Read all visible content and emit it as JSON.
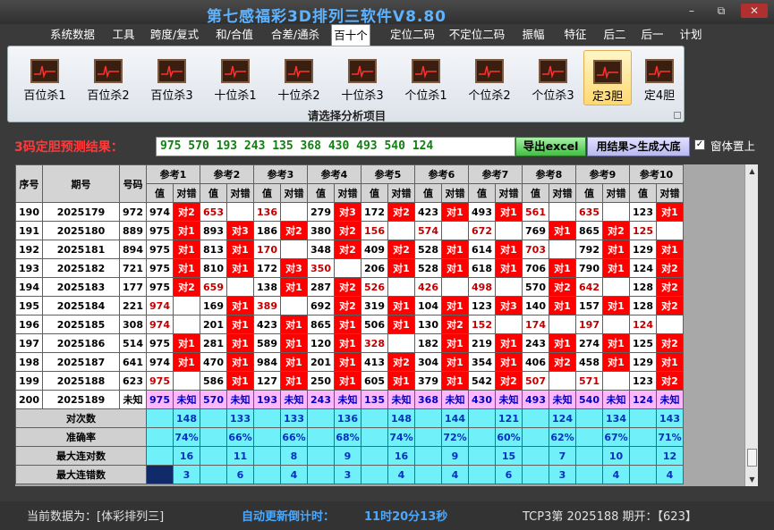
{
  "window": {
    "title": "第七感福彩3D排列三软件V8.80",
    "min": "–",
    "max": "⧉",
    "close": "✕"
  },
  "menu": [
    "系统数据",
    "工具",
    "跨度/复式",
    "和/合值",
    "合差/通杀",
    "百十个",
    "定位二码",
    "不定位二码",
    "振幅",
    "特征",
    "后二",
    "后一",
    "计划"
  ],
  "menu_active": 5,
  "ribbon": {
    "buttons": [
      "百位杀1",
      "百位杀2",
      "百位杀3",
      "十位杀1",
      "十位杀2",
      "十位杀3",
      "个位杀1",
      "个位杀2",
      "个位杀3",
      "定3胆",
      "定4胆"
    ],
    "selected": 9,
    "caption": "请选择分析项目",
    "icon": "chart-icon"
  },
  "predict": {
    "label": "3码定胆预测结果：",
    "value": "975 570 193 243 135 368 430 493 540 124",
    "export_label": "导出excel",
    "gen_label": "用结果>生成大底",
    "ontop_label": "窗体置上",
    "ontop_checked": "✓"
  },
  "table": {
    "col_headers": [
      "序号",
      "期号",
      "号码"
    ],
    "refs": [
      "参考1",
      "参考2",
      "参考3",
      "参考4",
      "参考5",
      "参考6",
      "参考7",
      "参考8",
      "参考9",
      "参考10"
    ],
    "sub": [
      "值",
      "对错"
    ],
    "rows": [
      {
        "no": "190",
        "issue": "2025179",
        "num": "972",
        "cells": [
          [
            "974",
            "对2"
          ],
          [
            "653",
            ""
          ],
          [
            "136",
            ""
          ],
          [
            "279",
            "对3"
          ],
          [
            "172",
            "对2"
          ],
          [
            "423",
            "对1"
          ],
          [
            "493",
            "对1"
          ],
          [
            "561",
            ""
          ],
          [
            "635",
            ""
          ],
          [
            "123",
            "对1"
          ]
        ]
      },
      {
        "no": "191",
        "issue": "2025180",
        "num": "889",
        "cells": [
          [
            "975",
            "对1"
          ],
          [
            "893",
            "对3"
          ],
          [
            "186",
            "对2"
          ],
          [
            "380",
            "对2"
          ],
          [
            "156",
            ""
          ],
          [
            "574",
            ""
          ],
          [
            "672",
            ""
          ],
          [
            "769",
            "对1"
          ],
          [
            "865",
            "对2"
          ],
          [
            "125",
            ""
          ]
        ]
      },
      {
        "no": "192",
        "issue": "2025181",
        "num": "894",
        "cells": [
          [
            "975",
            "对1"
          ],
          [
            "813",
            "对1"
          ],
          [
            "170",
            ""
          ],
          [
            "348",
            "对2"
          ],
          [
            "409",
            "对2"
          ],
          [
            "528",
            "对1"
          ],
          [
            "614",
            "对1"
          ],
          [
            "703",
            ""
          ],
          [
            "792",
            "对1"
          ],
          [
            "129",
            "对1"
          ]
        ]
      },
      {
        "no": "193",
        "issue": "2025182",
        "num": "721",
        "cells": [
          [
            "975",
            "对1"
          ],
          [
            "810",
            "对1"
          ],
          [
            "172",
            "对3"
          ],
          [
            "350",
            ""
          ],
          [
            "206",
            "对1"
          ],
          [
            "528",
            "对1"
          ],
          [
            "618",
            "对1"
          ],
          [
            "706",
            "对1"
          ],
          [
            "790",
            "对1"
          ],
          [
            "124",
            "对2"
          ]
        ]
      },
      {
        "no": "194",
        "issue": "2025183",
        "num": "177",
        "cells": [
          [
            "975",
            "对2"
          ],
          [
            "659",
            ""
          ],
          [
            "138",
            "对1"
          ],
          [
            "287",
            "对2"
          ],
          [
            "526",
            ""
          ],
          [
            "426",
            ""
          ],
          [
            "498",
            ""
          ],
          [
            "570",
            "对2"
          ],
          [
            "642",
            ""
          ],
          [
            "128",
            "对2"
          ]
        ]
      },
      {
        "no": "195",
        "issue": "2025184",
        "num": "221",
        "cells": [
          [
            "974",
            ""
          ],
          [
            "169",
            "对1"
          ],
          [
            "389",
            ""
          ],
          [
            "692",
            "对2"
          ],
          [
            "319",
            "对1"
          ],
          [
            "104",
            "对1"
          ],
          [
            "123",
            "对3"
          ],
          [
            "140",
            "对1"
          ],
          [
            "157",
            "对1"
          ],
          [
            "128",
            "对2"
          ]
        ]
      },
      {
        "no": "196",
        "issue": "2025185",
        "num": "308",
        "cells": [
          [
            "974",
            ""
          ],
          [
            "201",
            "对1"
          ],
          [
            "423",
            "对1"
          ],
          [
            "865",
            "对1"
          ],
          [
            "506",
            "对1"
          ],
          [
            "130",
            "对2"
          ],
          [
            "152",
            ""
          ],
          [
            "174",
            ""
          ],
          [
            "197",
            ""
          ],
          [
            "124",
            ""
          ]
        ]
      },
      {
        "no": "197",
        "issue": "2025186",
        "num": "514",
        "cells": [
          [
            "975",
            "对1"
          ],
          [
            "281",
            "对1"
          ],
          [
            "589",
            "对1"
          ],
          [
            "120",
            "对1"
          ],
          [
            "328",
            ""
          ],
          [
            "182",
            "对1"
          ],
          [
            "219",
            "对1"
          ],
          [
            "243",
            "对1"
          ],
          [
            "274",
            "对1"
          ],
          [
            "125",
            "对2"
          ]
        ]
      },
      {
        "no": "198",
        "issue": "2025187",
        "num": "641",
        "cells": [
          [
            "974",
            "对1"
          ],
          [
            "470",
            "对1"
          ],
          [
            "984",
            "对1"
          ],
          [
            "201",
            "对1"
          ],
          [
            "413",
            "对2"
          ],
          [
            "304",
            "对1"
          ],
          [
            "354",
            "对1"
          ],
          [
            "406",
            "对2"
          ],
          [
            "458",
            "对1"
          ],
          [
            "129",
            "对1"
          ]
        ]
      },
      {
        "no": "199",
        "issue": "2025188",
        "num": "623",
        "cells": [
          [
            "975",
            ""
          ],
          [
            "586",
            "对1"
          ],
          [
            "127",
            "对1"
          ],
          [
            "250",
            "对1"
          ],
          [
            "605",
            "对1"
          ],
          [
            "379",
            "对1"
          ],
          [
            "542",
            "对2"
          ],
          [
            "507",
            ""
          ],
          [
            "571",
            ""
          ],
          [
            "123",
            "对2"
          ]
        ]
      }
    ],
    "pred_row": {
      "no": "200",
      "issue": "2025189",
      "num": "未知",
      "cells": [
        [
          "975",
          "未知"
        ],
        [
          "570",
          "未知"
        ],
        [
          "193",
          "未知"
        ],
        [
          "243",
          "未知"
        ],
        [
          "135",
          "未知"
        ],
        [
          "368",
          "未知"
        ],
        [
          "430",
          "未知"
        ],
        [
          "493",
          "未知"
        ],
        [
          "540",
          "未知"
        ],
        [
          "124",
          "未知"
        ]
      ]
    },
    "stats": [
      {
        "label": "对次数",
        "vals": [
          "148",
          "133",
          "133",
          "136",
          "148",
          "144",
          "121",
          "124",
          "134",
          "143"
        ]
      },
      {
        "label": "准确率",
        "vals": [
          "74%",
          "66%",
          "66%",
          "68%",
          "74%",
          "72%",
          "60%",
          "62%",
          "67%",
          "71%"
        ]
      },
      {
        "label": "最大连对数",
        "vals": [
          "16",
          "11",
          "8",
          "9",
          "16",
          "9",
          "15",
          "7",
          "10",
          "12"
        ]
      },
      {
        "label": "最大连错数",
        "vals": [
          "3",
          "6",
          "4",
          "3",
          "4",
          "4",
          "6",
          "3",
          "4",
          "4"
        ]
      }
    ]
  },
  "status": {
    "current": "当前数据为：[体彩排列三]",
    "countdown_label": "自动更新倒计时：",
    "countdown": "11时20分13秒",
    "draw": "TCP3第 2025188 期开：【623】"
  }
}
